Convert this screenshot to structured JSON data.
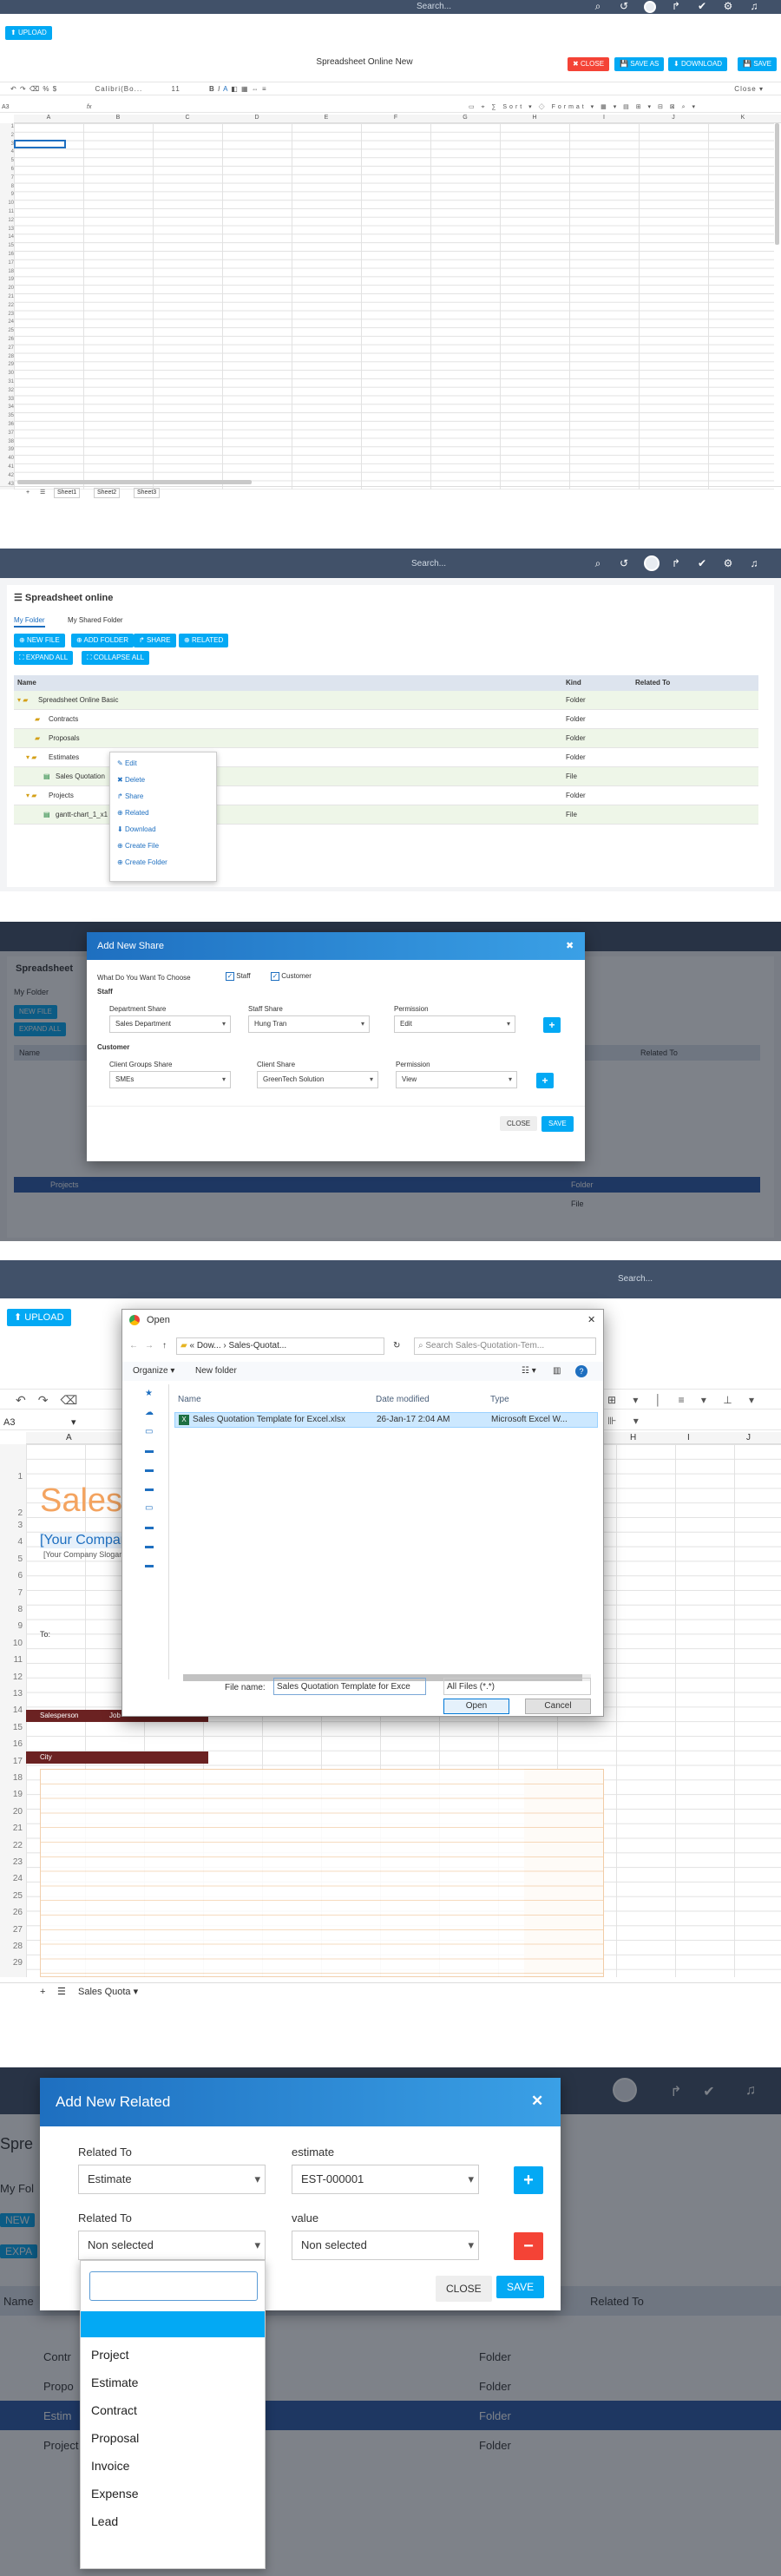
{
  "s1": {
    "search": "Search...",
    "upload": "UPLOAD",
    "doc_title": "Spreadsheet Online New",
    "close": "CLOSE",
    "save_as": "SAVE AS",
    "download": "DOWNLOAD",
    "save": "SAVE",
    "cell_ref": "A3",
    "fx": "fx",
    "font": "Calibri(Bo...",
    "font_size": "11",
    "columns": [
      "A",
      "B",
      "C",
      "D",
      "E",
      "F",
      "G",
      "H",
      "I",
      "J",
      "K",
      "L"
    ],
    "rows": [
      "1",
      "2",
      "3",
      "4",
      "5",
      "6",
      "7",
      "8",
      "9",
      "10",
      "11",
      "12",
      "13",
      "14",
      "15",
      "16",
      "17",
      "18",
      "19",
      "20",
      "21",
      "22",
      "23",
      "24",
      "25",
      "26",
      "27",
      "28",
      "29",
      "30",
      "31",
      "32",
      "33",
      "34",
      "35",
      "36",
      "37",
      "38",
      "39",
      "40",
      "41",
      "42",
      "43"
    ],
    "sheets": [
      "Sheet1",
      "Sheet2",
      "Sheet3"
    ],
    "zoom": "Close ▾"
  },
  "s2": {
    "search": "Search...",
    "panel_title": "Spreadsheet online",
    "tabs": [
      "My Folder",
      "My Shared Folder"
    ],
    "buttons": [
      "NEW FILE",
      "ADD FOLDER",
      "SHARE",
      "RELATED"
    ],
    "expand": "EXPAND ALL",
    "collapse": "COLLAPSE ALL",
    "col_name": "Name",
    "col_kind": "Kind",
    "col_related": "Related To",
    "rows": [
      {
        "name": "Spreadsheet Online Basic",
        "kind": "Folder"
      },
      {
        "name": "Contracts",
        "kind": "Folder"
      },
      {
        "name": "Proposals",
        "kind": "Folder"
      },
      {
        "name": "Estimates",
        "kind": "Folder"
      },
      {
        "name": "Sales Quotation",
        "kind": "File"
      },
      {
        "name": "Projects",
        "kind": "Folder"
      },
      {
        "name": "gantt-chart_1_x1",
        "kind": "File"
      }
    ],
    "context_menu": [
      "Edit",
      "Delete",
      "Share",
      "Related",
      "Download",
      "Create File",
      "Create Folder"
    ]
  },
  "s3": {
    "title": "Add New Share",
    "choose": "What Do You Want To Choose",
    "opt_staff": "Staff",
    "opt_customer": "Customer",
    "staff_label": "Staff",
    "dept_label": "Department Share",
    "dept_value": "Sales Department",
    "staffshare_label": "Staff Share",
    "staffshare_value": "Hung Tran",
    "perm_label": "Permission",
    "perm_value1": "Edit",
    "customer_label": "Customer",
    "client_group_label": "Client Groups Share",
    "client_group_value": "SMEs",
    "client_share_label": "Client Share",
    "client_share_value": "GreenTech Solution",
    "perm_value2": "View",
    "close": "CLOSE",
    "save": "SAVE",
    "bg": [
      "Spreadsheet",
      "My Folder",
      "NEW FILE",
      "EXPAND ALL",
      "Name",
      "Related To",
      "Folder",
      "Projects",
      "File"
    ]
  },
  "s4": {
    "search": "Search...",
    "upload": "UPLOAD",
    "dialog_title": "Open",
    "breadcrumb": "« Dow... › Sales-Quotat...",
    "search_ph": "Search Sales-Quotation-Tem...",
    "organize": "Organize ▾",
    "new_folder": "New folder",
    "col_name": "Name",
    "col_date": "Date modified",
    "col_type": "Type",
    "file_name": "Sales Quotation Template for Excel.xlsx",
    "file_date": "26-Jan-17 2:04 AM",
    "file_type": "Microsoft Excel W...",
    "fname_label": "File name:",
    "fname_value": "Sales Quotation Template for Exce",
    "filter": "All Files (*.*)",
    "open": "Open",
    "cancel": "Cancel",
    "cell_ref": "A3",
    "cols": [
      "A",
      "H",
      "I",
      "J"
    ],
    "big_text": "Sales",
    "company": "[Your Company Name]",
    "slogan": "[Your Company Slogan]",
    "to": "To:",
    "salesperson": "Salesperson",
    "job": "Job",
    "city": "City",
    "rows": [
      "1",
      "2",
      "3",
      "4",
      "5",
      "6",
      "7",
      "8",
      "9",
      "10",
      "11",
      "12",
      "13",
      "14",
      "15",
      "16",
      "17",
      "18",
      "19",
      "20",
      "21",
      "22",
      "23",
      "24",
      "25",
      "26",
      "27",
      "28",
      "29"
    ],
    "sheet": "Sales Quota ▾"
  },
  "s5": {
    "title": "Add New Related",
    "related_to_label": "Related To",
    "related_to_value": "Estimate",
    "estimate_label": "estimate",
    "estimate_value": "EST-000001",
    "related_to2_label": "Related To",
    "related_to2_value": "Non selected",
    "value_label": "value",
    "value_value": "Non selected",
    "close": "CLOSE",
    "save": "SAVE",
    "options": [
      "Project",
      "Estimate",
      "Contract",
      "Proposal",
      "Invoice",
      "Expense",
      "Lead"
    ],
    "bg": [
      "Spre",
      "My Fol",
      "NEW",
      "EXPA",
      "Name",
      "Related To",
      "Folder",
      "Folder",
      "Folder",
      "Folder",
      "Contr",
      "Propo",
      "Estim",
      "Project"
    ]
  }
}
